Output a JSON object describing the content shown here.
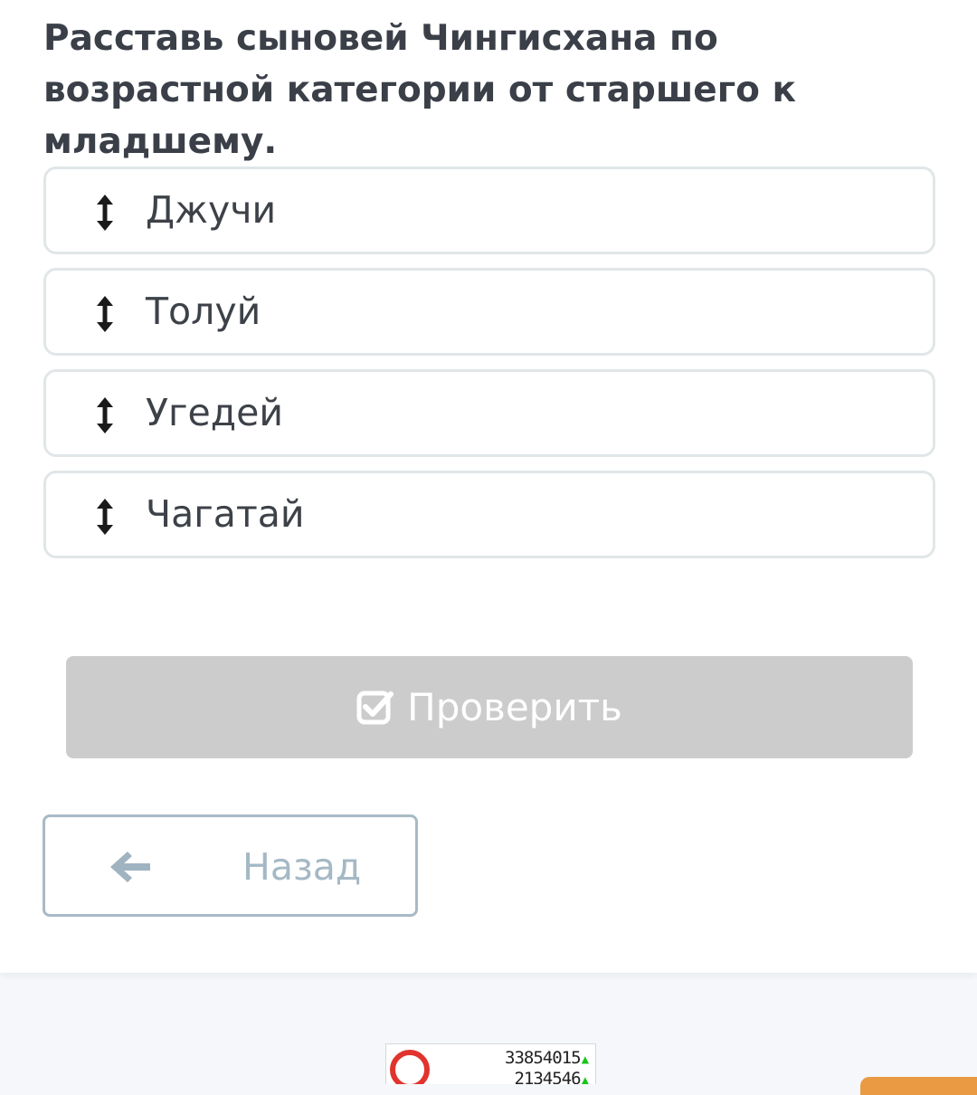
{
  "question": "Расставь сыновей Чингисхана по возрастной категории от старшего к младшему.",
  "options": [
    {
      "label": "Джучи",
      "icon": "vertical-arrows-icon"
    },
    {
      "label": "Толуй",
      "icon": "vertical-arrows-icon"
    },
    {
      "label": "Угедей",
      "icon": "vertical-arrows-icon"
    },
    {
      "label": "Чагатай",
      "icon": "vertical-arrows-icon"
    }
  ],
  "check_button": {
    "label": "Проверить",
    "icon": "checkbox-check-icon",
    "color": "#cccccc"
  },
  "back_button": {
    "label": "Назад",
    "icon": "arrow-left-icon",
    "color": "#a5b8c5"
  },
  "counter_widget": {
    "stats": [
      {
        "value": "33854015",
        "trend": "▲"
      },
      {
        "value": "2134546",
        "trend": "▲"
      }
    ]
  },
  "colors": {
    "text": "#3a3f48",
    "option_border": "#e1e6e8",
    "footer_background": "#f5f7fa",
    "trend_up": "#19c419",
    "accent_orange": "#e99a42"
  }
}
